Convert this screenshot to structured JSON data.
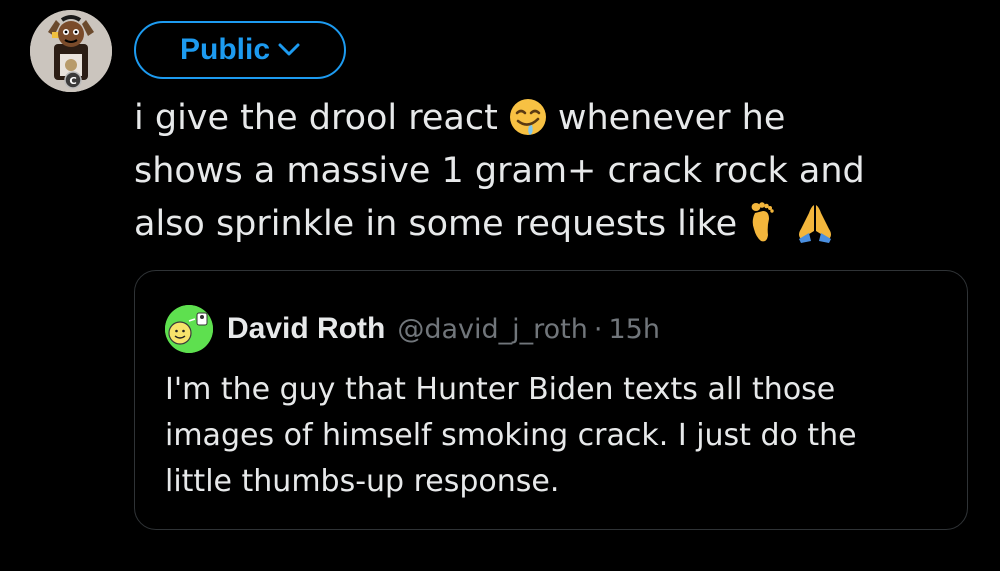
{
  "colors": {
    "background": "#000000",
    "text": "#e7e9ea",
    "accent": "#1d9bf0",
    "muted": "#71767b",
    "border": "#2f3336"
  },
  "audience_button": {
    "label": "Public",
    "icon": "chevron-down-icon"
  },
  "tweet": {
    "line1_before": "i give the drool react",
    "line1_emoji": "drooling-face-emoji",
    "line1_after": "whenever he",
    "line2": "shows a massive 1 gram+ crack rock and",
    "line3": "also sprinkle in some requests like",
    "line3_emojis": [
      "foot-emoji",
      "folded-hands-emoji"
    ]
  },
  "quote": {
    "name": "David Roth",
    "handle": "@david_j_roth",
    "separator": "·",
    "time": "15h",
    "lines": [
      "I'm the guy that Hunter Biden texts all those",
      "images of himself smoking crack. I just do the",
      "little thumbs-up response."
    ]
  }
}
